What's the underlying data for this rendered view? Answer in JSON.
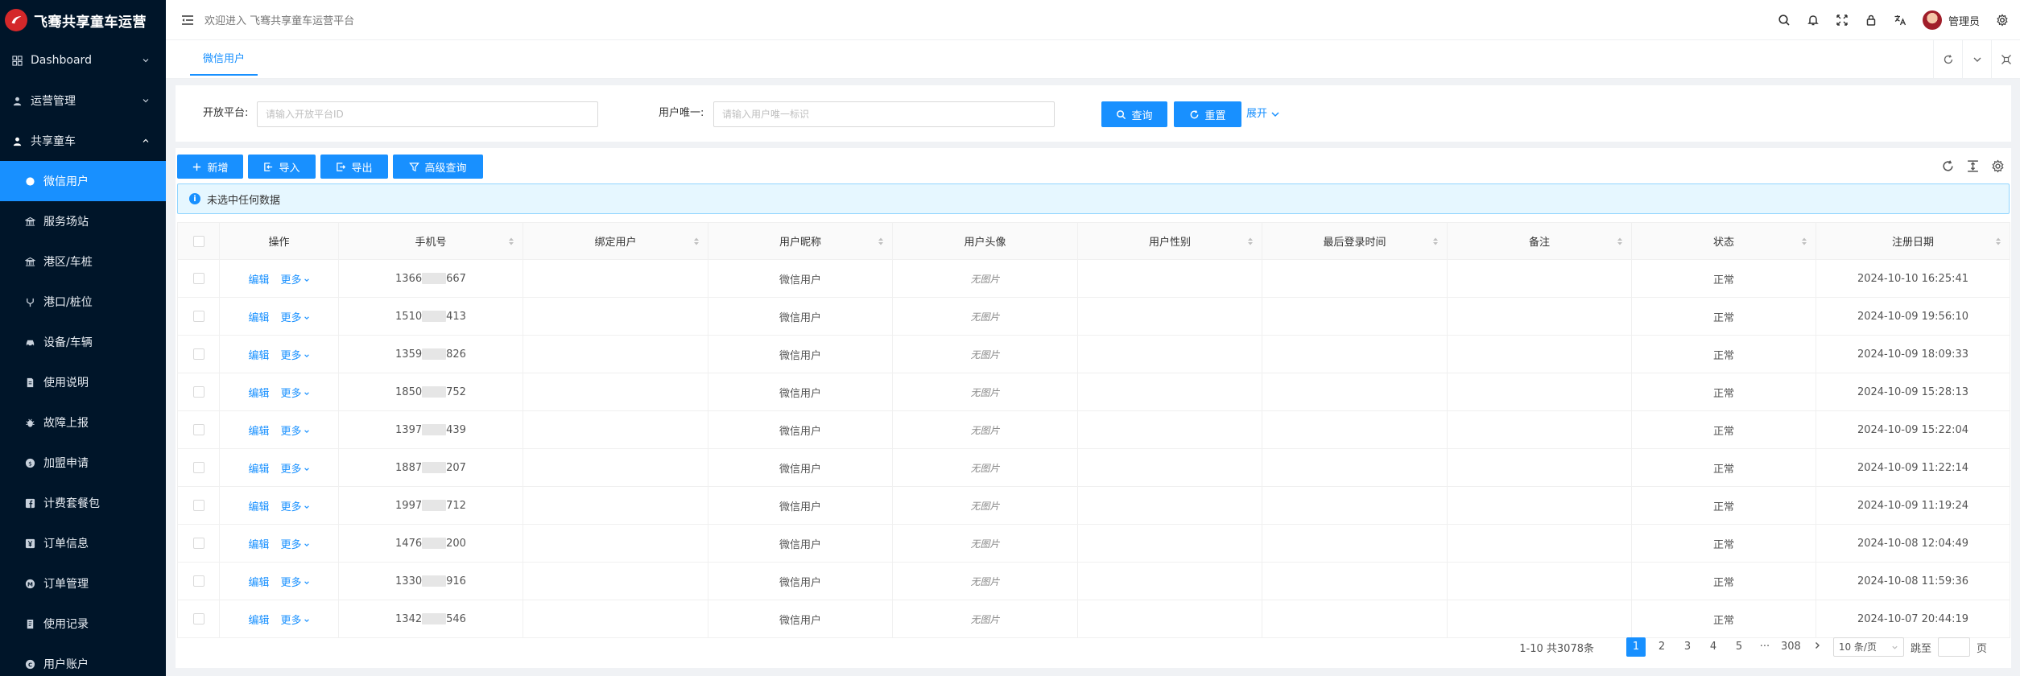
{
  "app": {
    "title": "飞骞共享童车运营",
    "welcome": "欢迎进入 飞骞共享童车运营平台",
    "brand_color": "#1890ff",
    "sidebar_bg": "#001529"
  },
  "sidebar": {
    "top_items": [
      {
        "label": "Dashboard",
        "icon": "dashboard-icon"
      },
      {
        "label": "运营管理",
        "icon": "user-icon"
      },
      {
        "label": "共享童车",
        "icon": "user-icon"
      }
    ],
    "sub_items": [
      {
        "label": "微信用户",
        "icon": "wechat-icon",
        "active": true
      },
      {
        "label": "服务场站",
        "icon": "bank-icon"
      },
      {
        "label": "港区/车桩",
        "icon": "bank-icon"
      },
      {
        "label": "港口/桩位",
        "icon": "fork-icon"
      },
      {
        "label": "设备/车辆",
        "icon": "car-icon"
      },
      {
        "label": "使用说明",
        "icon": "file-icon"
      },
      {
        "label": "故障上报",
        "icon": "bug-icon"
      },
      {
        "label": "加盟申请",
        "icon": "coin-icon"
      },
      {
        "label": "计费套餐包",
        "icon": "facebook-icon"
      },
      {
        "label": "订单信息",
        "icon": "yen-icon"
      },
      {
        "label": "订单管理",
        "icon": "medium-icon"
      },
      {
        "label": "使用记录",
        "icon": "record-icon"
      },
      {
        "label": "用户账户",
        "icon": "copyright-icon"
      }
    ]
  },
  "header": {
    "username": "管理员"
  },
  "tabs": [
    {
      "label": "微信用户"
    }
  ],
  "search": {
    "platform_label": "开放平台:",
    "platform_placeholder": "请输入开放平台ID",
    "unionid_label": "用户唯一:",
    "unionid_placeholder": "请输入用户唯一标识",
    "query_label": "查询",
    "reset_label": "重置",
    "expand_label": "展开"
  },
  "toolbar": {
    "add_label": "新增",
    "import_label": "导入",
    "export_label": "导出",
    "advanced_label": "高级查询"
  },
  "alert": {
    "text": "未选中任何数据"
  },
  "table": {
    "columns": [
      "操作",
      "手机号",
      "绑定用户",
      "用户昵称",
      "用户头像",
      "用户性别",
      "最后登录时间",
      "备注",
      "状态",
      "注册日期"
    ],
    "edit_label": "编辑",
    "more_label": "更多",
    "rows": [
      {
        "phone_pre": "1366",
        "phone_suf": "667",
        "nickname": "微信用户",
        "avatar": "无图片",
        "status": "正常",
        "date": "2024-10-10 16:25:41"
      },
      {
        "phone_pre": "1510",
        "phone_suf": "413",
        "nickname": "微信用户",
        "avatar": "无图片",
        "status": "正常",
        "date": "2024-10-09 19:56:10"
      },
      {
        "phone_pre": "1359",
        "phone_suf": "826",
        "nickname": "微信用户",
        "avatar": "无图片",
        "status": "正常",
        "date": "2024-10-09 18:09:33"
      },
      {
        "phone_pre": "1850",
        "phone_suf": "752",
        "nickname": "微信用户",
        "avatar": "无图片",
        "status": "正常",
        "date": "2024-10-09 15:28:13"
      },
      {
        "phone_pre": "1397",
        "phone_suf": "439",
        "nickname": "微信用户",
        "avatar": "无图片",
        "status": "正常",
        "date": "2024-10-09 15:22:04"
      },
      {
        "phone_pre": "1887",
        "phone_suf": "207",
        "nickname": "微信用户",
        "avatar": "无图片",
        "status": "正常",
        "date": "2024-10-09 11:22:14"
      },
      {
        "phone_pre": "1997",
        "phone_suf": "712",
        "nickname": "微信用户",
        "avatar": "无图片",
        "status": "正常",
        "date": "2024-10-09 11:19:24"
      },
      {
        "phone_pre": "1476",
        "phone_suf": "200",
        "nickname": "微信用户",
        "avatar": "无图片",
        "status": "正常",
        "date": "2024-10-08 12:04:49"
      },
      {
        "phone_pre": "1330",
        "phone_suf": "916",
        "nickname": "微信用户",
        "avatar": "无图片",
        "status": "正常",
        "date": "2024-10-08 11:59:36"
      },
      {
        "phone_pre": "1342",
        "phone_suf": "546",
        "nickname": "微信用户",
        "avatar": "无图片",
        "status": "正常",
        "date": "2024-10-07 20:44:19"
      }
    ]
  },
  "pagination": {
    "summary": "1-10 共3078条",
    "pages": [
      "1",
      "2",
      "3",
      "4",
      "5"
    ],
    "ellipsis": "···",
    "last_page": "308",
    "page_size": "10 条/页",
    "jump_label": "跳至",
    "page_unit": "页"
  }
}
